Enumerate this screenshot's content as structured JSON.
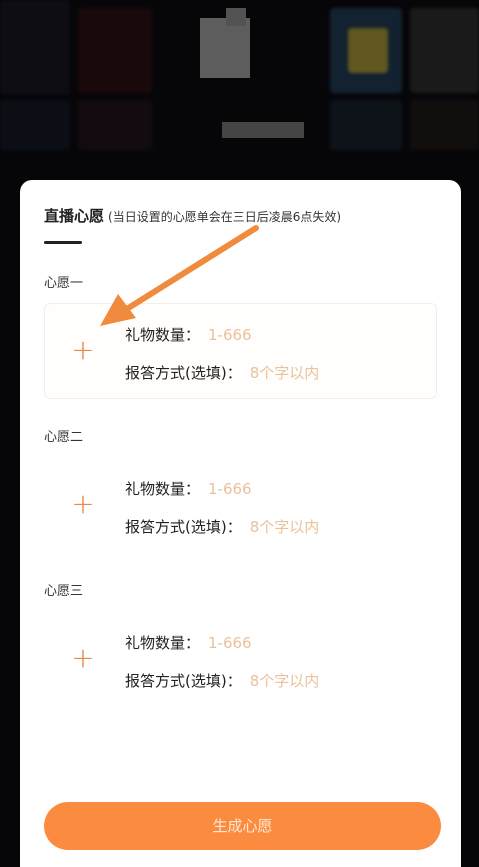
{
  "modal": {
    "title": "直播心愿",
    "subtitle": "(当日设置的心愿单会在三日后凌晨6点失效)"
  },
  "wishes": [
    {
      "label": "心愿一",
      "plus": "+",
      "gift_count_label": "礼物数量：",
      "gift_count_placeholder": "1-666",
      "reply_label": "报答方式(选填)：",
      "reply_placeholder": "8个字以内"
    },
    {
      "label": "心愿二",
      "plus": "+",
      "gift_count_label": "礼物数量：",
      "gift_count_placeholder": "1-666",
      "reply_label": "报答方式(选填)：",
      "reply_placeholder": "8个字以内"
    },
    {
      "label": "心愿三",
      "plus": "+",
      "gift_count_label": "礼物数量：",
      "gift_count_placeholder": "1-666",
      "reply_label": "报答方式(选填)：",
      "reply_placeholder": "8个字以内"
    }
  ],
  "generate_button": {
    "label": "生成心愿"
  },
  "colors": {
    "accent": "#fb8b3f",
    "plus": "#e8894a",
    "placeholder": "#e9c29b",
    "annotation_arrow": "#f08a3c"
  }
}
